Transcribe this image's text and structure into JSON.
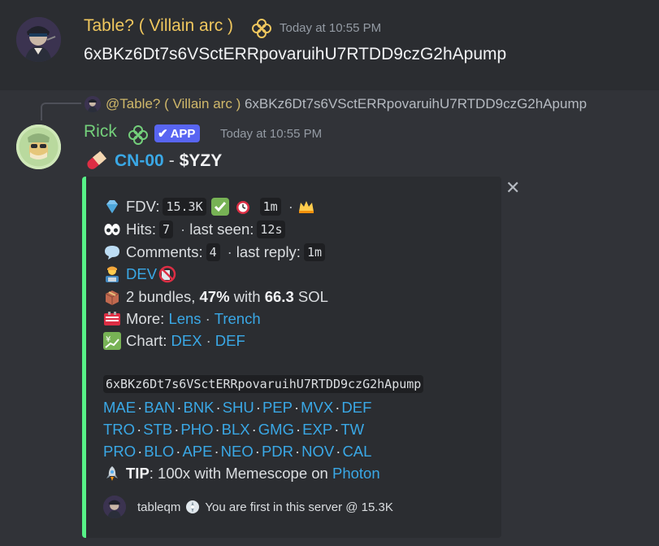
{
  "message1": {
    "username": "Table? ( Villain arc )",
    "timestamp": "Today at 10:55 PM",
    "content": "6xBKz6Dt7s6VSctERRpovaruihU7RTDD9czG2hApump"
  },
  "reply": {
    "mention": "@Table? ( Villain arc )",
    "content": "6xBKz6Dt7s6VSctERRpovaruihU7RTDD9czG2hApump"
  },
  "message2": {
    "username": "Rick",
    "app_badge": "APP",
    "timestamp": "Today at 10:55 PM",
    "title_link": "CN-00",
    "title_dash": "-",
    "title_ticker": "$YZY"
  },
  "embed": {
    "fdv_label": "FDV:",
    "fdv_value": "15.3K",
    "fdv_age": "1m",
    "hits_label": "Hits:",
    "hits_value": "7",
    "last_seen_label": "last seen:",
    "last_seen_value": "12s",
    "comments_label": "Comments:",
    "comments_value": "4",
    "last_reply_label": "last reply:",
    "last_reply_value": "1m",
    "dev_label": "DEV",
    "bundles_text": "2 bundles,",
    "bundles_pct": "47%",
    "bundles_with": "with",
    "bundles_sol": "66.3",
    "bundles_unit": "SOL",
    "more_label": "More:",
    "more_links": [
      "Lens",
      "Trench"
    ],
    "chart_label": "Chart:",
    "chart_links": [
      "DEX",
      "DEF"
    ],
    "mint": "6xBKz6Dt7s6VSctERRpovaruihU7RTDD9czG2hApump",
    "link_rows": [
      [
        "MAE",
        "BAN",
        "BNK",
        "SHU",
        "PEP",
        "MVX",
        "DEF"
      ],
      [
        "TRO",
        "STB",
        "PHO",
        "BLX",
        "GMG",
        "EXP",
        "TW"
      ],
      [
        "PRO",
        "BLO",
        "APE",
        "NEO",
        "PDR",
        "NOV",
        "CAL"
      ]
    ],
    "tip_label": "TIP",
    "tip_text": ": 100x with Memescope on",
    "tip_link": "Photon",
    "footer_user": "tableqm",
    "footer_text": "You are first in this server @ 15.3K",
    "dot": "·",
    "close": "✕"
  },
  "colors": {
    "background": "#313338",
    "highlight_background": "#2b2d31",
    "username1": "#f0c75e",
    "username2": "#74d07b",
    "link": "#3aa8e6",
    "embed_border": "#57f287",
    "app_badge": "#5865f2"
  },
  "icons": {
    "role": "flower-role-icon",
    "title": "pill-icon",
    "fdv": "gem-icon",
    "fdv_check": "check-mark-icon",
    "fdv_clock": "alarm-clock-icon",
    "fdv_crown": "crown-icon",
    "hits": "eyes-icon",
    "comments": "speech-bubble-icon",
    "dev": "technologist-icon",
    "dev_status": "no-entry-icon",
    "bundles": "package-icon",
    "more": "card-index-icon",
    "chart": "chart-yen-icon",
    "tip": "rocket-icon",
    "footer": "compass-icon"
  }
}
